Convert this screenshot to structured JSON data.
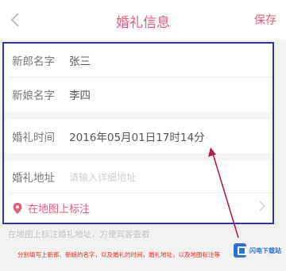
{
  "header": {
    "title": "婚礼信息",
    "save_label": "保存"
  },
  "form": {
    "groom_label": "新郎名字",
    "groom_value": "张三",
    "bride_label": "新娘名字",
    "bride_value": "李四",
    "time_label": "婚礼时间",
    "time_value": "2016年05月01日17时14分",
    "address_label": "婚礼地址",
    "address_placeholder": "请输入详细地址",
    "map_label": "在地图上标注"
  },
  "hint": "在地图上标注婚礼地址，方便宾客查看",
  "caption": "分别填写上新郎、新娘的名字，以及婚礼的时间，婚礼地址，以及地图标注等",
  "watermark": "闪电下载站",
  "colors": {
    "accent": "#e85a7a",
    "highlight_box": "#2f2fb8",
    "caption_text": "#e0291c"
  },
  "icons": [
    "back-arrow-icon",
    "location-pin-icon",
    "chevron-right-icon",
    "download-site-logo-icon"
  ]
}
